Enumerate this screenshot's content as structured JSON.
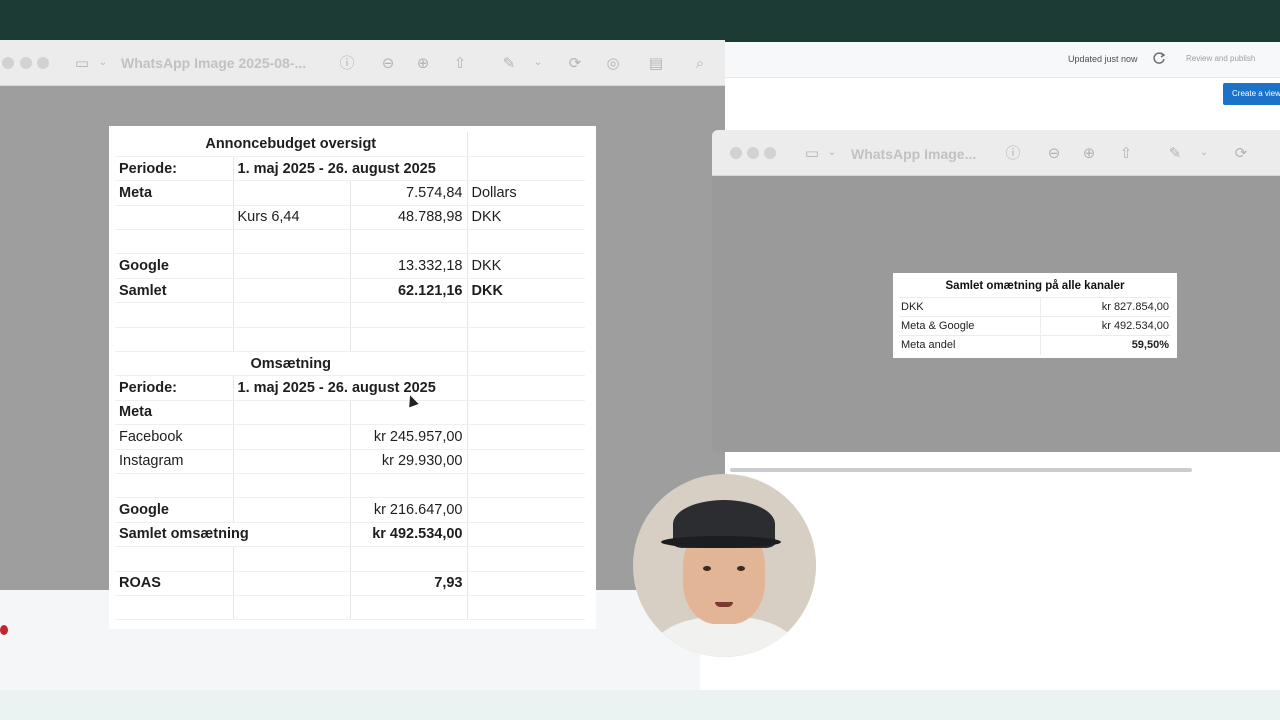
{
  "bg_app": {
    "status": "Updated just now",
    "review_label": "Review and publish",
    "create_label": "Create a view"
  },
  "window1": {
    "title": "WhatsApp Image 2025-08-..."
  },
  "window2": {
    "title": "WhatsApp Image..."
  },
  "sheet": {
    "budget_title": "Annoncebudget oversigt",
    "periode_label": "Periode:",
    "periode_value": "1. maj 2025 - 26. august 2025",
    "meta_label": "Meta",
    "meta_value": "7.574,84",
    "meta_unit": "Dollars",
    "kurs_label": "Kurs 6,44",
    "kurs_value": "48.788,98",
    "kurs_unit": "DKK",
    "google_label": "Google",
    "google_value": "13.332,18",
    "google_unit": "DKK",
    "samlet_label": "Samlet",
    "samlet_value": "62.121,16",
    "samlet_unit": "DKK",
    "oms_title": "Omsætning",
    "oms_periode_label": "Periode:",
    "oms_periode_value": "1. maj 2025 - 26. august 2025",
    "oms_meta_label": "Meta",
    "facebook_label": "Facebook",
    "facebook_value": "kr 245.957,00",
    "instagram_label": "Instagram",
    "instagram_value": "kr 29.930,00",
    "oms_google_label": "Google",
    "oms_google_value": "kr 216.647,00",
    "samlet_oms_label": "Samlet omsætning",
    "samlet_oms_value": "kr 492.534,00",
    "roas_label": "ROAS",
    "roas_value": "7,93"
  },
  "card": {
    "title": "Samlet omætning på alle kanaler",
    "rows": [
      {
        "label": "DKK",
        "value": "kr 827.854,00"
      },
      {
        "label": "Meta & Google",
        "value": "kr 492.534,00"
      },
      {
        "label": "Meta andel",
        "value": "59,50%"
      }
    ]
  },
  "colors": {
    "top_strip": "#1c3b35",
    "accent_button": "#1a73c8"
  }
}
